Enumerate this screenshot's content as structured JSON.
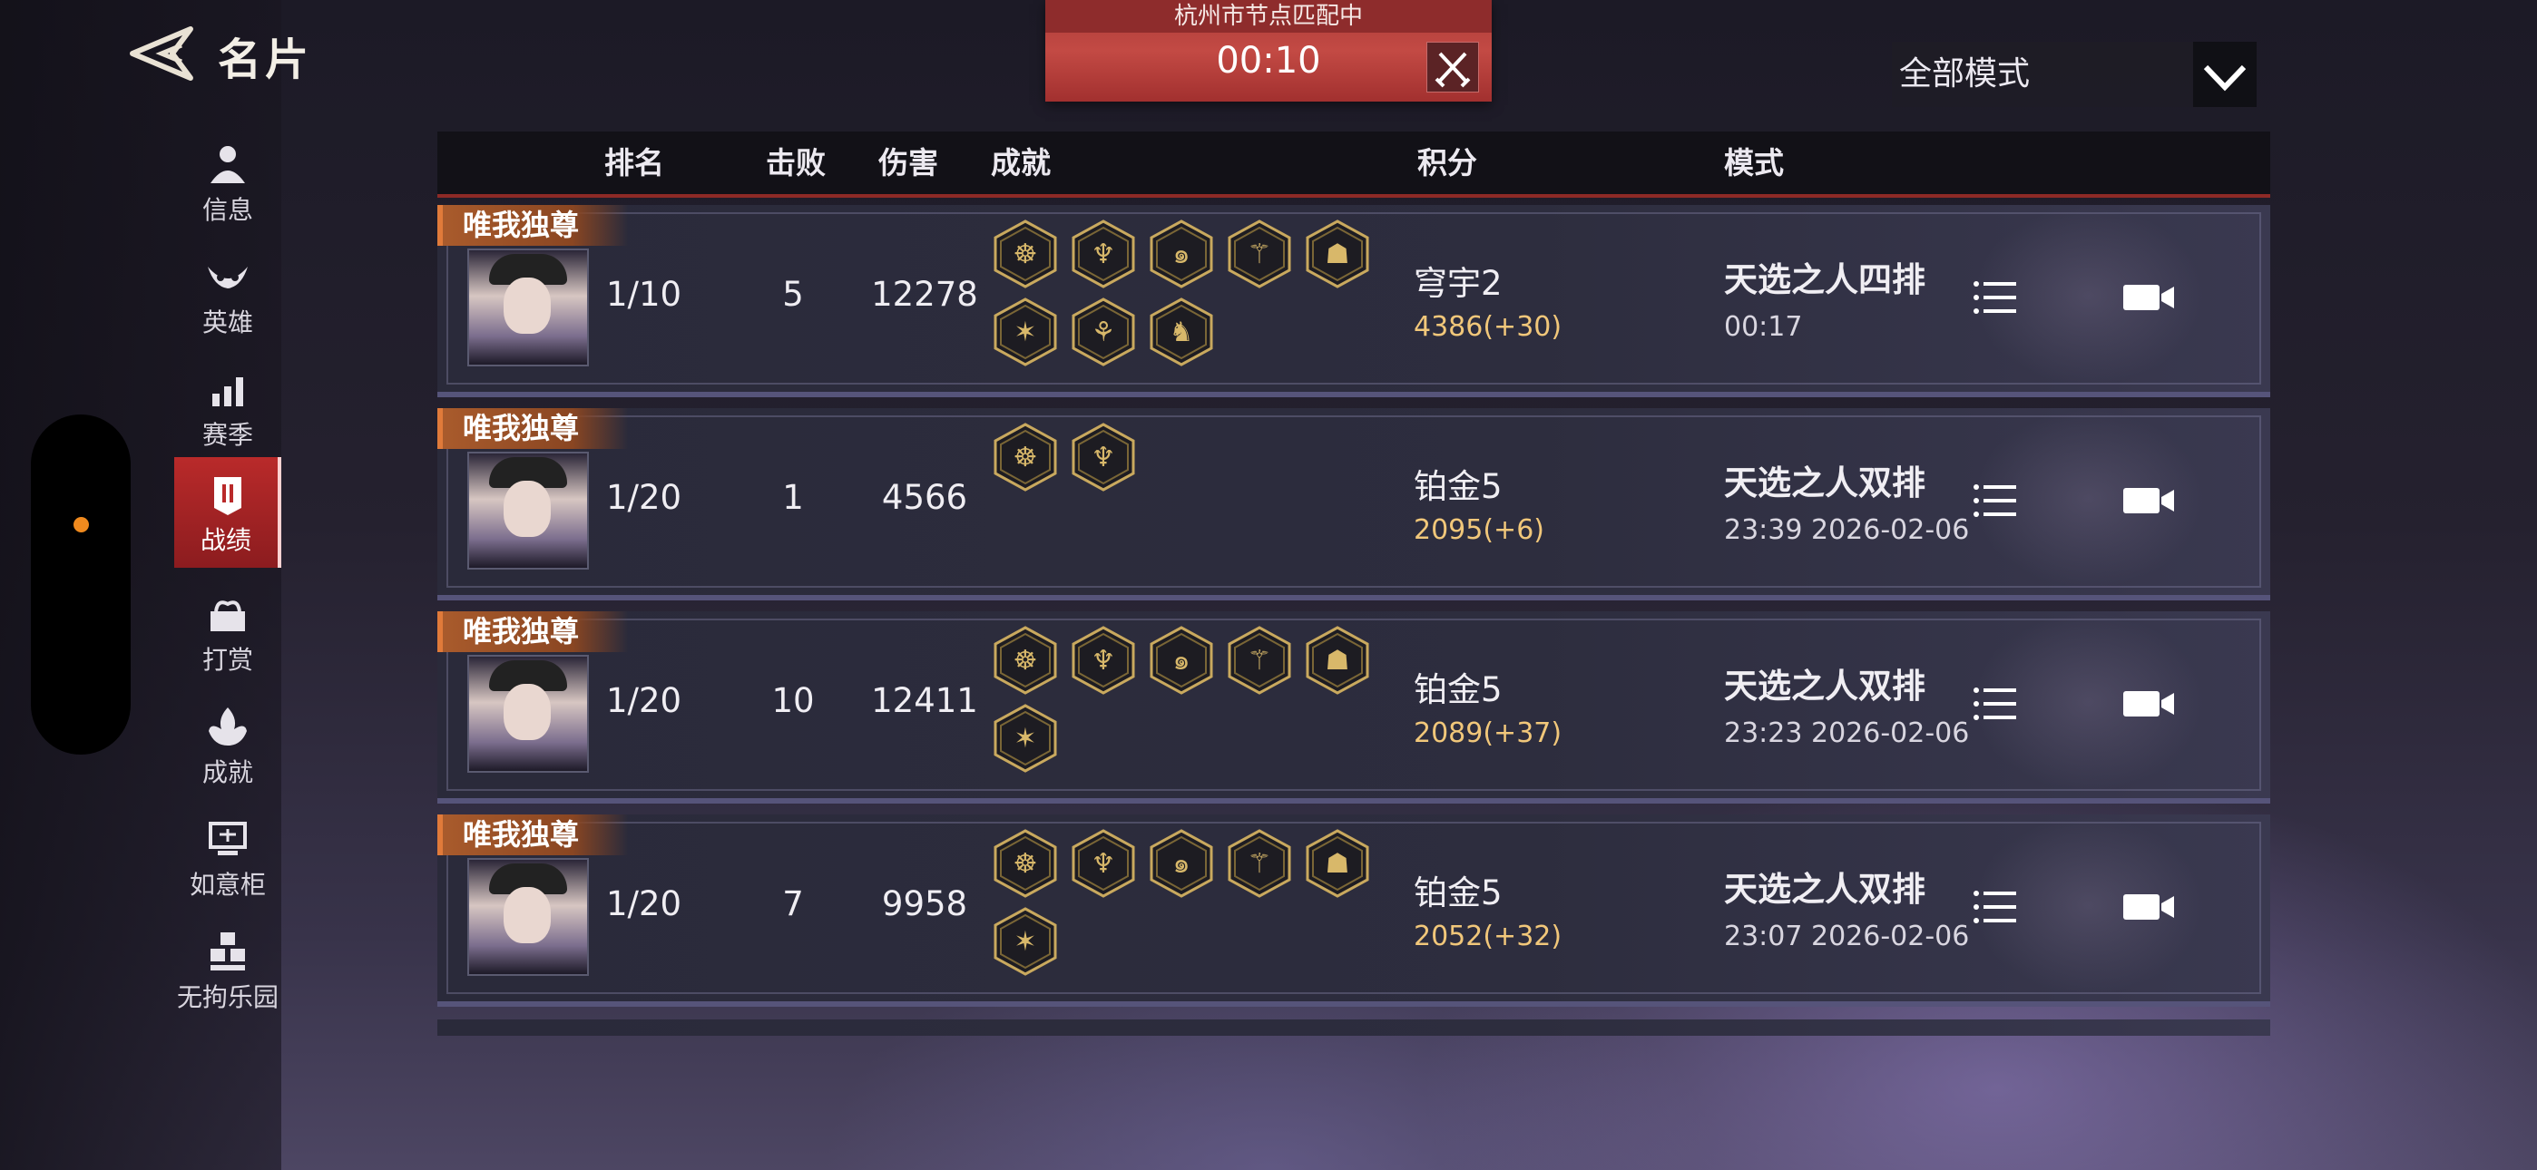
{
  "header": {
    "title": "名片"
  },
  "match": {
    "city": "杭州市节点匹配中",
    "timer": "00:10"
  },
  "mode_filter": {
    "selected": "全部模式"
  },
  "sidebar": {
    "items": [
      {
        "label": "信息",
        "icon": "person-icon"
      },
      {
        "label": "英雄",
        "icon": "hero-mask-icon"
      },
      {
        "label": "赛季",
        "icon": "bar-chart-icon"
      },
      {
        "label": "战绩",
        "icon": "record-icon",
        "active": true
      },
      {
        "label": "打赏",
        "icon": "reward-icon"
      },
      {
        "label": "成就",
        "icon": "achievement-icon"
      },
      {
        "label": "如意柜",
        "icon": "cabinet-icon"
      },
      {
        "label": "无拘乐园",
        "icon": "park-icon"
      }
    ]
  },
  "table": {
    "headers": {
      "rank": "排名",
      "kills": "击败",
      "damage": "伤害",
      "achievements": "成就",
      "score": "积分",
      "mode": "模式"
    }
  },
  "rows": [
    {
      "tag": "唯我独尊",
      "rank": "1/10",
      "kills": "5",
      "damage": "12278",
      "badge_count": 8,
      "tier": "穹宇2",
      "points": "4386(+30)",
      "mode": "天选之人四排",
      "time": "00:17"
    },
    {
      "tag": "唯我独尊",
      "rank": "1/20",
      "kills": "1",
      "damage": "4566",
      "badge_count": 2,
      "tier": "铂金5",
      "points": "2095(+6)",
      "mode": "天选之人双排",
      "time": "23:39  2026-02-06"
    },
    {
      "tag": "唯我独尊",
      "rank": "1/20",
      "kills": "10",
      "damage": "12411",
      "badge_count": 6,
      "tier": "铂金5",
      "points": "2089(+37)",
      "mode": "天选之人双排",
      "time": "23:23  2026-02-06"
    },
    {
      "tag": "唯我独尊",
      "rank": "1/20",
      "kills": "7",
      "damage": "9958",
      "badge_count": 6,
      "tier": "铂金5",
      "points": "2052(+32)",
      "mode": "天选之人双排",
      "time": "23:07  2026-02-06"
    }
  ],
  "colors": {
    "accent_red": "#b92a2a",
    "gold": "#f1c77a",
    "tag_orange": "#a95b2c"
  }
}
